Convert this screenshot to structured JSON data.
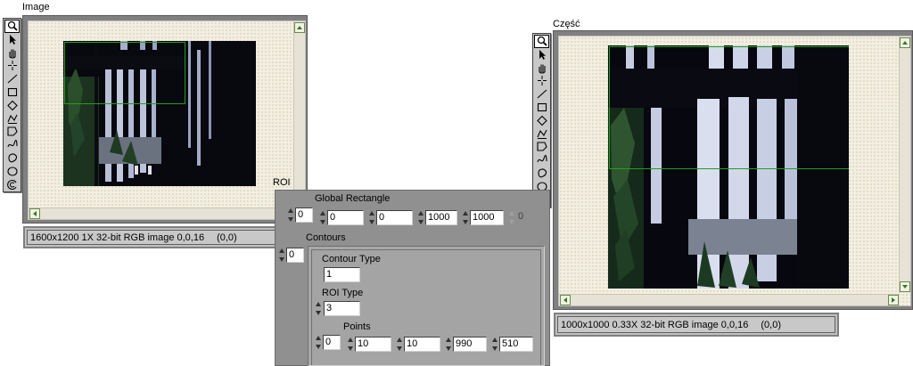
{
  "left_display": {
    "label": "Image",
    "status": {
      "info": "1600x1200 1X 32-bit RGB image 0,0,16",
      "coords": "(0,0)"
    }
  },
  "right_display": {
    "label": "Część",
    "status": {
      "info": "1000x1000 0.33X 32-bit RGB image 0,0,16",
      "coords": "(0,0)"
    }
  },
  "tools": [
    {
      "name": "zoom",
      "icon": "magnifier-icon"
    },
    {
      "name": "select",
      "icon": "arrow-icon"
    },
    {
      "name": "pan",
      "icon": "hand-icon"
    },
    {
      "name": "point",
      "icon": "crosshair-icon"
    },
    {
      "name": "line",
      "icon": "line-icon"
    },
    {
      "name": "rectangle",
      "icon": "rectangle-icon"
    },
    {
      "name": "rotated-rectangle",
      "icon": "diamond-icon"
    },
    {
      "name": "polyline",
      "icon": "polyline-icon"
    },
    {
      "name": "polygon",
      "icon": "polygon-icon"
    },
    {
      "name": "freehand-line",
      "icon": "freehand-icon"
    },
    {
      "name": "freehand-region",
      "icon": "freehand-region-icon"
    },
    {
      "name": "oval",
      "icon": "oval-icon"
    },
    {
      "name": "annulus",
      "icon": "annulus-icon"
    }
  ],
  "roi": {
    "label": "ROI",
    "global_rectangle": {
      "label": "Global Rectangle",
      "index": "0",
      "values": [
        "0",
        "0",
        "1000",
        "1000"
      ],
      "extra": "0"
    },
    "contours": {
      "label": "Contours",
      "index": "0",
      "contour_type_label": "Contour Type",
      "contour_type": "1",
      "roi_type_label": "ROI Type",
      "roi_type": "3",
      "points_label": "Points",
      "points_index": "0",
      "points": [
        "10",
        "10",
        "990",
        "510"
      ]
    }
  },
  "colors": {
    "roi_outline": "#20a020",
    "scroll_arrow": "#2f7d1e",
    "frame": "#808080",
    "panel": "#909090"
  }
}
